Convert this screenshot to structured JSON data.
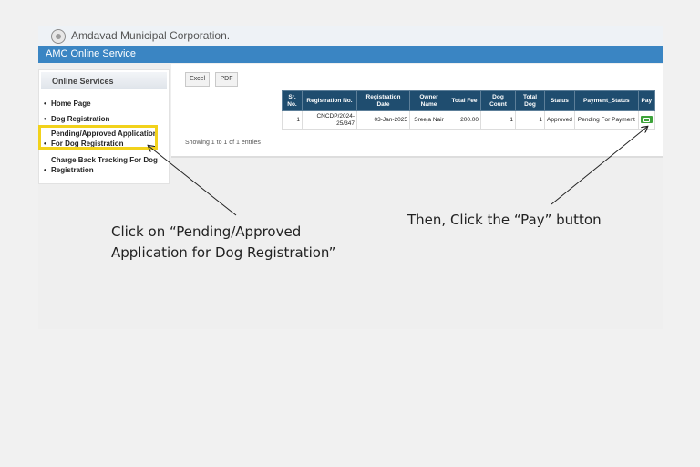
{
  "header": {
    "site_title": "Amdavad Municipal Corporation.",
    "service_title": "AMC Online Service"
  },
  "sidebar": {
    "heading": "Online Services",
    "items": [
      {
        "label": "Home Page"
      },
      {
        "label": "Dog Registration"
      },
      {
        "label": "Pending/Approved Application For Dog Registration"
      },
      {
        "label": "Charge Back Tracking For Dog Registration"
      }
    ]
  },
  "toolbar": {
    "excel_label": "Excel",
    "pdf_label": "PDF"
  },
  "table": {
    "columns": [
      "Sr. No.",
      "Registration No.",
      "Registration Date",
      "Owner Name",
      "Total Fee",
      "Dog Count",
      "Total Dog",
      "Status",
      "Payment_Status",
      "Pay"
    ],
    "rows": [
      {
        "sr_no": "1",
        "registration_no": "CNCDP/2024-25/347",
        "registration_date": "03-Jan-2025",
        "owner_name": "Sreeja Nair",
        "total_fee": "200.00",
        "dog_count": "1",
        "total_dog": "1",
        "status": "Approved",
        "payment_status": "Pending For Payment"
      }
    ],
    "info": "Showing 1 to 1 of 1 entries"
  },
  "instructions": {
    "step1": "Click on “Pending/Approved Application for Dog Registration”",
    "step2": "Then, Click the “Pay” button"
  },
  "colors": {
    "service_bar": "#3a85c3",
    "table_header": "#1f4d6f",
    "highlight": "#f2d21b",
    "pay_button": "#3da33a"
  }
}
